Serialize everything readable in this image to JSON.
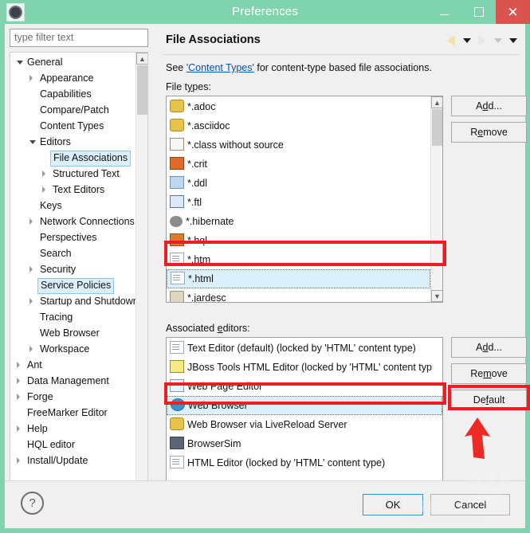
{
  "window": {
    "title": "Preferences",
    "icon": "gear-icon",
    "titlebar_color": "#7fd3ae",
    "close_color": "#d9534f",
    "buttons": {
      "minimize": "–",
      "maximize": "□",
      "close": "✕"
    }
  },
  "sidebar": {
    "filter": {
      "placeholder": "type filter text",
      "value": ""
    },
    "items": [
      {
        "label": "General",
        "indent": 0,
        "state": "expanded",
        "selected": false
      },
      {
        "label": "Appearance",
        "indent": 1,
        "state": "collapsed",
        "selected": false
      },
      {
        "label": "Capabilities",
        "indent": 1,
        "state": "leaf",
        "selected": false
      },
      {
        "label": "Compare/Patch",
        "indent": 1,
        "state": "leaf",
        "selected": false
      },
      {
        "label": "Content Types",
        "indent": 1,
        "state": "leaf",
        "selected": false
      },
      {
        "label": "Editors",
        "indent": 1,
        "state": "expanded",
        "selected": false
      },
      {
        "label": "File Associations",
        "indent": 2,
        "state": "leaf",
        "selected": true
      },
      {
        "label": "Structured Text",
        "indent": 2,
        "state": "collapsed",
        "selected": false
      },
      {
        "label": "Text Editors",
        "indent": 2,
        "state": "collapsed",
        "selected": false
      },
      {
        "label": "Keys",
        "indent": 1,
        "state": "leaf",
        "selected": false
      },
      {
        "label": "Network Connections",
        "indent": 1,
        "state": "collapsed",
        "selected": false
      },
      {
        "label": "Perspectives",
        "indent": 1,
        "state": "leaf",
        "selected": false
      },
      {
        "label": "Search",
        "indent": 1,
        "state": "leaf",
        "selected": false
      },
      {
        "label": "Security",
        "indent": 1,
        "state": "collapsed",
        "selected": false
      },
      {
        "label": "Service Policies",
        "indent": 1,
        "state": "leaf",
        "selected": true
      },
      {
        "label": "Startup and Shutdown",
        "indent": 1,
        "state": "collapsed",
        "selected": false
      },
      {
        "label": "Tracing",
        "indent": 1,
        "state": "leaf",
        "selected": false
      },
      {
        "label": "Web Browser",
        "indent": 1,
        "state": "leaf",
        "selected": false
      },
      {
        "label": "Workspace",
        "indent": 1,
        "state": "collapsed",
        "selected": false
      },
      {
        "label": "Ant",
        "indent": 0,
        "state": "collapsed",
        "selected": false
      },
      {
        "label": "Data Management",
        "indent": 0,
        "state": "collapsed",
        "selected": false
      },
      {
        "label": "Forge",
        "indent": 0,
        "state": "collapsed",
        "selected": false
      },
      {
        "label": "FreeMarker Editor",
        "indent": 0,
        "state": "leaf",
        "selected": false
      },
      {
        "label": "Help",
        "indent": 0,
        "state": "collapsed",
        "selected": false
      },
      {
        "label": "HQL editor",
        "indent": 0,
        "state": "leaf",
        "selected": false
      },
      {
        "label": "Install/Update",
        "indent": 0,
        "state": "collapsed",
        "selected": false
      }
    ]
  },
  "page": {
    "title": "File Associations",
    "nav": {
      "back": "back-arrow-icon",
      "back_menu": "chevron-down-icon",
      "forward": "forward-arrow-icon",
      "forward_menu": "chevron-down-icon",
      "view_menu": "chevron-down-icon"
    },
    "description_prefix": "See ",
    "description_link": "'Content Types'",
    "description_suffix": " for content-type based file associations.",
    "file_types_label_a": "File t",
    "file_types_label_u": "y",
    "file_types_label_b": "pes:",
    "assoc_label_a": "Associated ",
    "assoc_label_u": "e",
    "assoc_label_b": "ditors:"
  },
  "file_types": {
    "items": [
      {
        "label": "*.adoc",
        "icon": "asciidoc-icon",
        "selected": false
      },
      {
        "label": "*.asciidoc",
        "icon": "asciidoc-icon",
        "selected": false
      },
      {
        "label": "*.class without source",
        "icon": "class-file-icon",
        "selected": false
      },
      {
        "label": "*.crit",
        "icon": "crit-file-icon",
        "selected": false
      },
      {
        "label": "*.ddl",
        "icon": "ddl-file-icon",
        "selected": false
      },
      {
        "label": "*.ftl",
        "icon": "ftl-file-icon",
        "selected": false
      },
      {
        "label": "*.hibernate",
        "icon": "hibernate-icon",
        "selected": false
      },
      {
        "label": "*.hql",
        "icon": "hql-file-icon",
        "selected": false
      },
      {
        "label": "*.htm",
        "icon": "document-icon",
        "selected": false
      },
      {
        "label": "*.html",
        "icon": "document-icon",
        "selected": true
      },
      {
        "label": "*.jardesc",
        "icon": "jar-desc-icon",
        "selected": false
      }
    ],
    "buttons": {
      "add_a": "A",
      "add_u": "d",
      "add_b": "d...",
      "remove_a": "R",
      "remove_u": "e",
      "remove_b": "move"
    },
    "scroll": {
      "up": "⌃",
      "down": "⌄"
    }
  },
  "associated_editors": {
    "items": [
      {
        "label": "Text Editor (default) (locked by 'HTML' content type)",
        "icon": "text-editor-icon",
        "selected": false
      },
      {
        "label": "JBoss Tools HTML Editor (locked by 'HTML' content typ",
        "icon": "html-editor-icon",
        "selected": false
      },
      {
        "label": "Web Page Editor",
        "icon": "web-page-editor-icon",
        "selected": false
      },
      {
        "label": "Web Browser",
        "icon": "web-browser-icon",
        "selected": true
      },
      {
        "label": "Web Browser via LiveReload Server",
        "icon": "livereload-icon",
        "selected": false
      },
      {
        "label": "BrowserSim",
        "icon": "browsersim-icon",
        "selected": false
      },
      {
        "label": "HTML Editor (locked by 'HTML' content type)",
        "icon": "text-editor-icon",
        "selected": false
      }
    ],
    "buttons": {
      "add_a": "A",
      "add_u": "d",
      "add_b": "d...",
      "remove_a": "Re",
      "remove_u": "m",
      "remove_b": "ove",
      "default_a": "De",
      "default_u": "f",
      "default_b": "ault"
    },
    "scroll": {
      "left": "‹",
      "right": "›"
    }
  },
  "footer": {
    "help": "?",
    "ok": "OK",
    "cancel": "Cancel"
  },
  "annotations": {
    "highlight_color": "#ee1c24",
    "arrow": "red-up-arrow-annotation"
  },
  "watermark": {
    "brand": "Baidu",
    "sub": "jingyan.baidu.com"
  }
}
